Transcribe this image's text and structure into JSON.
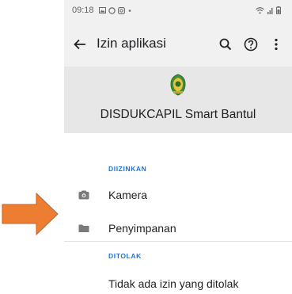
{
  "status_bar": {
    "time": "09:18"
  },
  "app_bar": {
    "title": "Izin aplikasi",
    "icons": [
      "back-arrow-icon",
      "search-icon",
      "help-icon",
      "more-vert-icon"
    ]
  },
  "app_info": {
    "name": "DISDUKCAPIL Smart Bantul"
  },
  "allowed": {
    "label": "DIIZINKAN",
    "items": [
      {
        "label": "Kamera",
        "icon": "camera-icon"
      },
      {
        "label": "Penyimpanan",
        "icon": "folder-icon"
      }
    ]
  },
  "denied": {
    "label": "DITOLAK",
    "empty_text": "Tidak ada izin yang ditolak"
  },
  "colors": {
    "accent": "#1a73e8",
    "bar_background": "#f1f1f1",
    "header_background": "#e7e7e7",
    "pointer_arrow": "#ed7d31"
  }
}
